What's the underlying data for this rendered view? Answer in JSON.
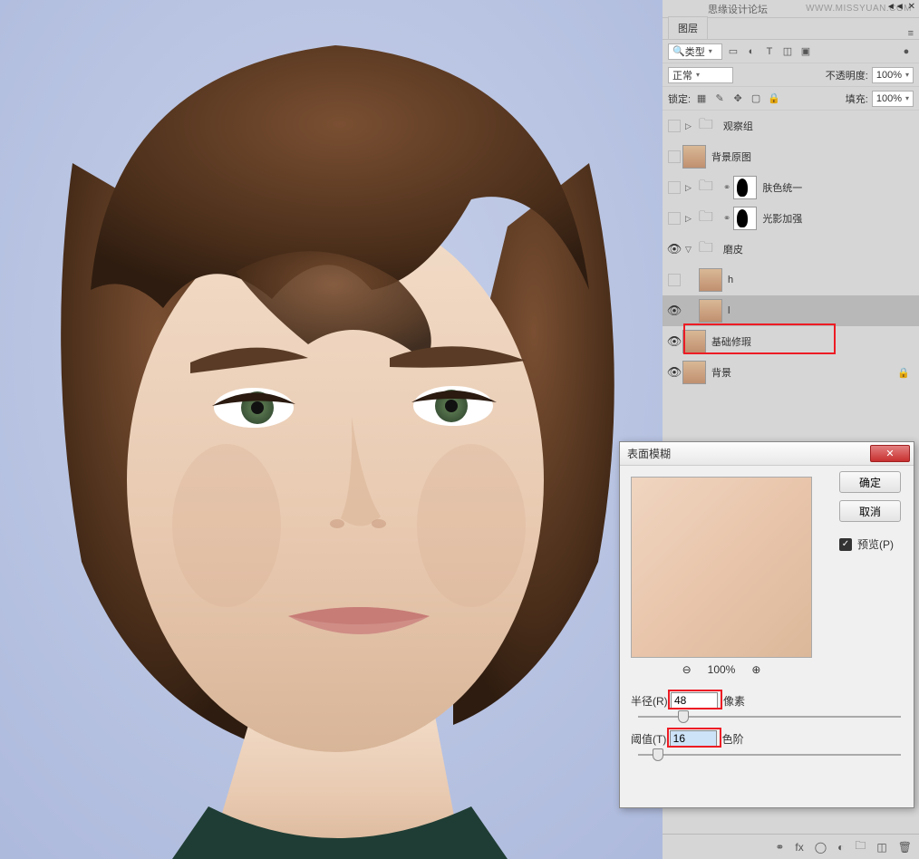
{
  "header": {
    "site_name": "思缘设计论坛",
    "site_url": "WWW.MISSYUAN.COM"
  },
  "panel": {
    "tab": "图层",
    "filter": {
      "kind_label": "类型",
      "search_icon": "🔍"
    },
    "blend": {
      "mode": "正常",
      "opacity_label": "不透明度:",
      "opacity_value": "100%",
      "lock_label": "锁定:",
      "fill_label": "填充:",
      "fill_value": "100%"
    },
    "layers": [
      {
        "name": "观察组",
        "type": "folder",
        "visible": false,
        "disclosure": ">"
      },
      {
        "name": "背景原图",
        "type": "face",
        "visible": false
      },
      {
        "name": "肤色统一",
        "type": "folder-mask",
        "visible": false,
        "disclosure": ">"
      },
      {
        "name": "光影加强",
        "type": "folder-mask",
        "visible": false,
        "disclosure": ">"
      },
      {
        "name": "磨皮",
        "type": "folder",
        "visible": true,
        "disclosure": "v",
        "open": true
      },
      {
        "name": "h",
        "type": "face",
        "visible": false,
        "indent": true
      },
      {
        "name": "l",
        "type": "face",
        "visible": true,
        "indent": true,
        "selected": true
      },
      {
        "name": "基础修瑕",
        "type": "face",
        "visible": true
      },
      {
        "name": "背景",
        "type": "face",
        "visible": true,
        "locked": true
      }
    ]
  },
  "dialog": {
    "title": "表面模糊",
    "ok": "确定",
    "cancel": "取消",
    "preview_label": "预览(P)",
    "zoom": "100%",
    "radius_label": "半径(R):",
    "radius_value": "48",
    "radius_unit": "像素",
    "threshold_label": "阈值(T):",
    "threshold_value": "16",
    "threshold_unit": "色阶"
  }
}
